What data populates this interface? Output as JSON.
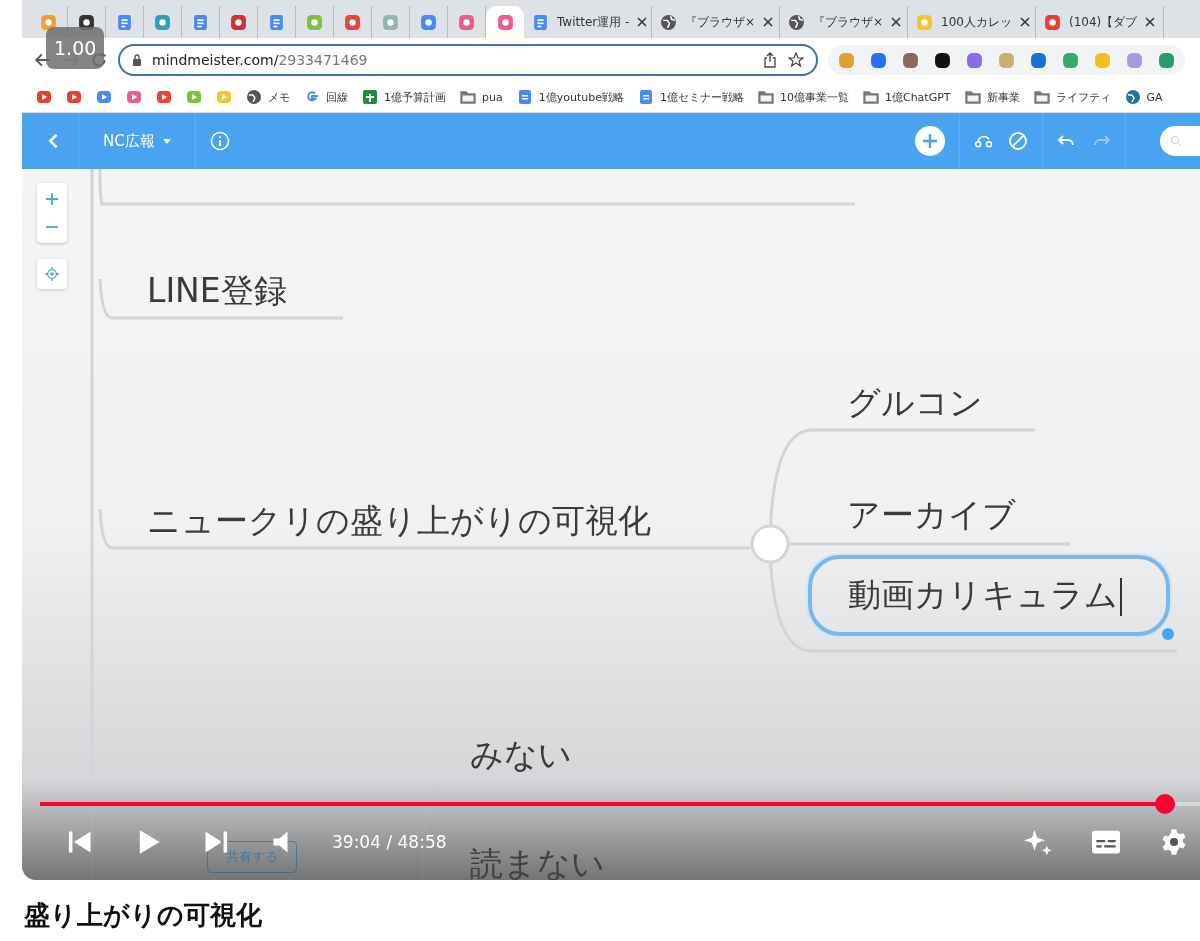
{
  "video": {
    "speed_badge": "1.00",
    "browser": {
      "tabs": [
        {
          "kind": "app",
          "color": "#f0a030",
          "selected": false
        },
        {
          "kind": "app",
          "color": "#333333",
          "selected": false
        },
        {
          "kind": "doc",
          "color": "#4a8af4",
          "selected": false
        },
        {
          "kind": "app",
          "color": "#2a9fbf",
          "selected": false
        },
        {
          "kind": "doc",
          "color": "#4a8af4",
          "selected": false
        },
        {
          "kind": "app",
          "color": "#d0302f",
          "selected": false
        },
        {
          "kind": "doc",
          "color": "#4a8af4",
          "selected": false
        },
        {
          "kind": "app",
          "color": "#7cc242",
          "selected": false
        },
        {
          "kind": "app",
          "color": "#ea4335",
          "selected": false
        },
        {
          "kind": "app",
          "color": "#8fb8a8",
          "selected": false
        },
        {
          "kind": "app",
          "color": "#4a8af4",
          "selected": false
        },
        {
          "kind": "app",
          "color": "#e8608a",
          "selected": false
        },
        {
          "kind": "app",
          "color": "#e8608a",
          "selected": true
        },
        {
          "kind": "doc",
          "color": "#4a8af4",
          "title": "Twitter運用 -",
          "selected": false
        },
        {
          "kind": "globe",
          "color": "#555555",
          "title": "『ブラウザ×",
          "selected": false
        },
        {
          "kind": "globe",
          "color": "#555555",
          "title": "『ブラウザ×",
          "selected": false
        },
        {
          "kind": "app",
          "color": "#f4c430",
          "title": "100人カレッ",
          "selected": false
        },
        {
          "kind": "app",
          "color": "#e8402a",
          "title": "(104)【ダブ",
          "selected": false
        }
      ],
      "url_host": "mindmeister.com/",
      "url_path": "2933471469",
      "extensions": [
        {
          "color": "#e0a030"
        },
        {
          "color": "#2a6ff0"
        },
        {
          "color": "#8a6a5a"
        },
        {
          "color": "#111111"
        },
        {
          "color": "#8a6ae8"
        },
        {
          "color": "#c8b070"
        },
        {
          "color": "#1a70d8"
        },
        {
          "color": "#3aa86a"
        },
        {
          "color": "#f0c020"
        },
        {
          "color": "#a89ad8"
        },
        {
          "color": "#2a9a6a"
        }
      ],
      "bookmarks": [
        {
          "kind": "icon",
          "color": "#e8402a"
        },
        {
          "kind": "icon",
          "color": "#e8402a"
        },
        {
          "kind": "icon",
          "color": "#4a8af4"
        },
        {
          "kind": "icon",
          "color": "#e8608a"
        },
        {
          "kind": "icon",
          "color": "#ea4335"
        },
        {
          "kind": "icon",
          "color": "#7cc242"
        },
        {
          "kind": "icon",
          "color": "#f4c430"
        },
        {
          "kind": "globe",
          "color": "#555555",
          "label": "メモ"
        },
        {
          "kind": "google",
          "color": "#4a8af4",
          "label": "回線"
        },
        {
          "kind": "sheet",
          "color": "#1e8e3e",
          "label": "1億予算計画"
        },
        {
          "kind": "folder",
          "color": "#777777",
          "label": "pua"
        },
        {
          "kind": "doc",
          "color": "#4a8af4",
          "label": "1億youtube戦略"
        },
        {
          "kind": "doc",
          "color": "#4a8af4",
          "label": "1億セミナー戦略"
        },
        {
          "kind": "folder",
          "color": "#777777",
          "label": "10億事業一覧"
        },
        {
          "kind": "folder",
          "color": "#777777",
          "label": "1億ChatGPT"
        },
        {
          "kind": "folder",
          "color": "#777777",
          "label": "新事業"
        },
        {
          "kind": "folder",
          "color": "#777777",
          "label": "ライフティ"
        },
        {
          "kind": "globe",
          "color": "#21759b",
          "label": "GA"
        }
      ]
    },
    "app": {
      "map_title": "NC広報",
      "redo_disabled": true,
      "nodes": [
        {
          "text": "LINE登録",
          "selected": false
        },
        {
          "text": "ニュークリの盛り上がりの可視化",
          "selected": false
        },
        {
          "text": "グルコン",
          "selected": false
        },
        {
          "text": "アーカイブ",
          "selected": false
        },
        {
          "text": "動画カリキュラム",
          "selected": true
        },
        {
          "text": "みない",
          "selected": false
        },
        {
          "text": "読まない",
          "selected": false
        }
      ],
      "share_button": "共有する"
    },
    "player": {
      "level": 0.97,
      "time": "39:04 / 48:58"
    }
  },
  "title": "盛り上がりの可視化"
}
